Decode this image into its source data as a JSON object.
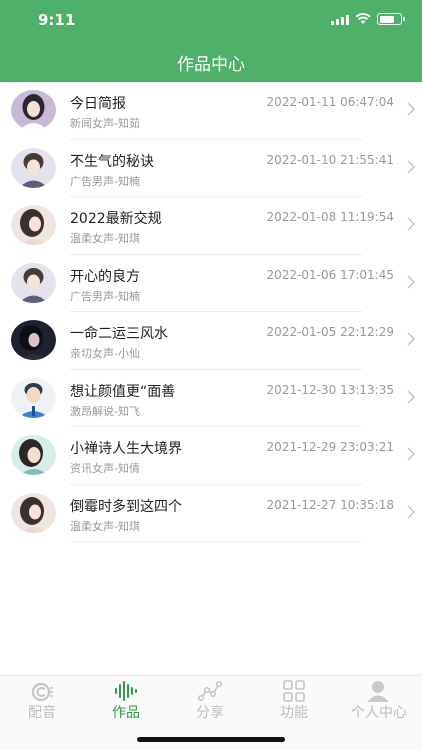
{
  "status_bar": {
    "time": "9:11"
  },
  "header": {
    "title": "作品中心"
  },
  "items": [
    {
      "title": "今日简报",
      "subtitle": "新闻女声-知茹",
      "time": "2022-01-11 06:47:04"
    },
    {
      "title": "不生气的秘诀",
      "subtitle": "广告男声-知楠",
      "time": "2022-01-10 21:55:41"
    },
    {
      "title": "2022最新交规",
      "subtitle": "温柔女声-知琪",
      "time": "2022-01-08 11:19:54"
    },
    {
      "title": "开心的良方",
      "subtitle": "广告男声-知楠",
      "time": "2022-01-06 17:01:45"
    },
    {
      "title": "一命二运三风水",
      "subtitle": "亲切女声-小仙",
      "time": "2022-01-05 22:12:29"
    },
    {
      "title": "想让颜值更“面善",
      "subtitle": "激昂解说-知飞",
      "time": "2021-12-30 13:13:35"
    },
    {
      "title": "小禅诗人生大境界",
      "subtitle": "资讯女声-知倩",
      "time": "2021-12-29 23:03:21"
    },
    {
      "title": "倒霉时多到这四个",
      "subtitle": "温柔女声-知琪",
      "time": "2021-12-27 10:35:18"
    }
  ],
  "tabs": [
    {
      "label": "配音",
      "icon": "voice-icon"
    },
    {
      "label": "作品",
      "icon": "soundwave-icon",
      "active": true
    },
    {
      "label": "分享",
      "icon": "share-graph-icon"
    },
    {
      "label": "功能",
      "icon": "grid-icon"
    },
    {
      "label": "个人中心",
      "icon": "person-icon"
    }
  ],
  "colors": {
    "header": "#4fb06a",
    "active_tab": "#2e9b48",
    "inactive_tab": "#bdbdbd"
  }
}
